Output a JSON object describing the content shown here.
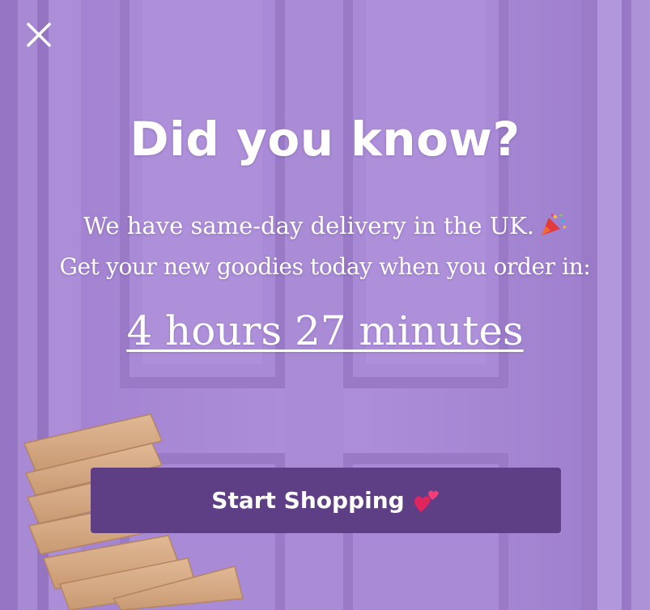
{
  "popup": {
    "close_label": "Close",
    "title": "Did you know?",
    "message_line1": "We have same-day delivery in the UK.",
    "message_line2": "Get your new goodies today when you order in:",
    "countdown": "4 hours 27 minutes",
    "cta_label": "Start Shopping",
    "colors": {
      "background": "#a98bd6",
      "button": "#5e3f86",
      "text": "#ffffff"
    },
    "icons": {
      "close": "close-icon",
      "party": "party-popper-emoji",
      "hearts": "two-hearts-emoji"
    }
  }
}
